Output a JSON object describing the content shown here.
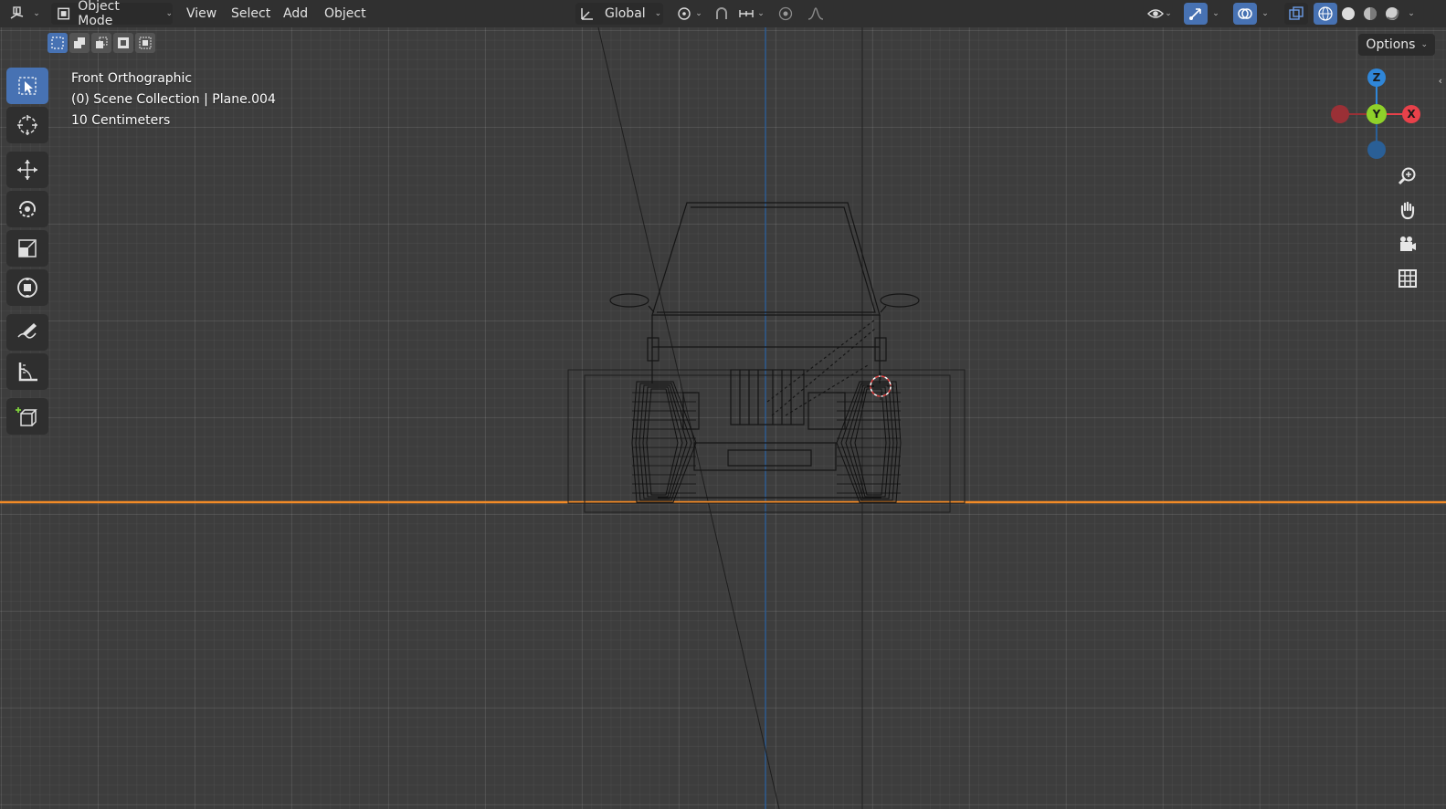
{
  "header": {
    "editor_type_icon": "view3d-icon",
    "mode_label": "Object Mode",
    "menus": [
      "View",
      "Select",
      "Add",
      "Object"
    ],
    "orientation_label": "Global",
    "pivot_icon": "pivot-icon",
    "snap_icon": "magnet-icon",
    "proportional_icon": "proportional-edit-icon",
    "visibility_icon": "eye-icon",
    "gizmo_icon": "gizmo-icon",
    "overlay_icon": "overlay-icon",
    "xray_icon": "xray-icon",
    "shading_modes": [
      "wireframe",
      "solid",
      "material",
      "rendered"
    ],
    "options_label": "Options"
  },
  "viewport": {
    "view_name": "Front Orthographic",
    "collection_info": "(0) Scene Collection | Plane.004",
    "grid_scale": "10 Centimeters"
  },
  "toolbar": {
    "tools": [
      "select-box",
      "cursor",
      "move",
      "rotate",
      "scale",
      "transform",
      "annotate",
      "measure",
      "add-cube"
    ]
  },
  "gizmo": {
    "axes": [
      "Z",
      "Y",
      "X"
    ],
    "colors": {
      "x": "#e8414a",
      "y": "#8fd12a",
      "z": "#2f86d8"
    }
  },
  "colors": {
    "header_bg": "#303030",
    "viewport_bg": "#3d3d3d",
    "active_blue": "#4772b3",
    "selection_orange": "#f28b27"
  }
}
